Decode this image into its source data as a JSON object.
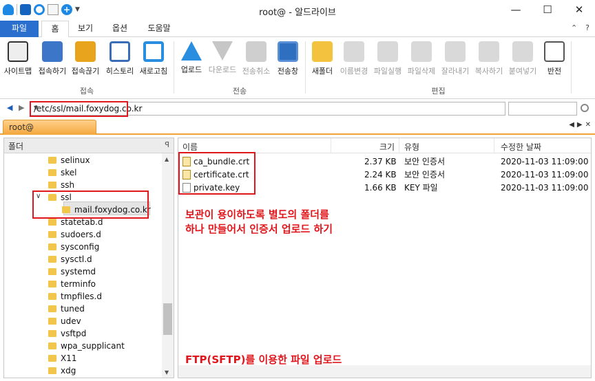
{
  "window": {
    "title": "root@ - 알드라이브"
  },
  "ribbon_tabs": [
    {
      "label": "파일"
    },
    {
      "label": "홈"
    },
    {
      "label": "보기"
    },
    {
      "label": "옵션"
    },
    {
      "label": "도움말"
    }
  ],
  "ribbon": {
    "connect": [
      {
        "label": "사이트맵"
      },
      {
        "label": "접속하기"
      },
      {
        "label": "접속끊기"
      },
      {
        "label": "히스토리"
      },
      {
        "label": "새로고침"
      }
    ],
    "connect_group": "접속",
    "transfer": [
      {
        "label": "업로드"
      },
      {
        "label": "다운로드"
      },
      {
        "label": "전송취소"
      },
      {
        "label": "전송창"
      }
    ],
    "transfer_group": "전송",
    "edit": [
      {
        "label": "새폴더"
      },
      {
        "label": "이름변경"
      },
      {
        "label": "파일실행"
      },
      {
        "label": "파일삭제"
      },
      {
        "label": "잘라내기"
      },
      {
        "label": "복사하기"
      },
      {
        "label": "붙여넣기"
      },
      {
        "label": "반전"
      }
    ],
    "edit_group": "편집"
  },
  "address": {
    "path": "/etc/ssl/mail.foxydog.co.kr"
  },
  "panel_tab": {
    "label": "root@"
  },
  "folder_pane": {
    "header": "폴더",
    "items": [
      {
        "label": "selinux"
      },
      {
        "label": "skel"
      },
      {
        "label": "ssh"
      },
      {
        "label": "ssl"
      },
      {
        "label": "mail.foxydog.co.kr"
      },
      {
        "label": "statetab.d"
      },
      {
        "label": "sudoers.d"
      },
      {
        "label": "sysconfig"
      },
      {
        "label": "sysctl.d"
      },
      {
        "label": "systemd"
      },
      {
        "label": "terminfo"
      },
      {
        "label": "tmpfiles.d"
      },
      {
        "label": "tuned"
      },
      {
        "label": "udev"
      },
      {
        "label": "vsftpd"
      },
      {
        "label": "wpa_supplicant"
      },
      {
        "label": "X11"
      },
      {
        "label": "xdg"
      }
    ]
  },
  "file_pane": {
    "columns": {
      "name": "이름",
      "size": "크기",
      "type": "유형",
      "modified": "수정한 날짜"
    },
    "files": [
      {
        "name": "ca_bundle.crt",
        "size": "2.37 KB",
        "type": "보안 인증서",
        "modified": "2020-11-03 11:09:00"
      },
      {
        "name": "certificate.crt",
        "size": "2.24 KB",
        "type": "보안 인증서",
        "modified": "2020-11-03 11:09:00"
      },
      {
        "name": "private.key",
        "size": "1.66 KB",
        "type": "KEY 파일",
        "modified": "2020-11-03 11:09:00"
      }
    ]
  },
  "annotations": {
    "line1": "보관이 용이하도록 별도의 폴더를",
    "line2": "하나 만들어서 인증서 업로드 하기",
    "bottom": "FTP(SFTP)를 이용한 파일 업로드"
  },
  "colors": {
    "accent": "#2b6fce",
    "highlight": "#e0161d",
    "tab_orange": "#f4a73e"
  }
}
